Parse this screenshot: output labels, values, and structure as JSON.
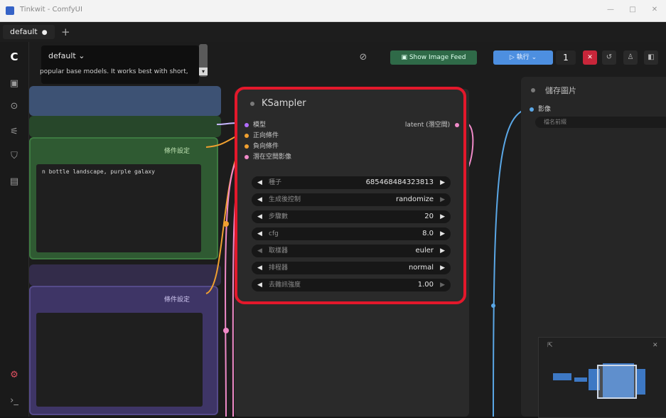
{
  "window": {
    "title": "Tinkwit - ComfyUI",
    "minimize": "—",
    "maximize": "□",
    "close": "✕"
  },
  "tabs": [
    {
      "label": "default",
      "modified_marker": "●"
    }
  ],
  "tab_add": "+",
  "sidebar": {
    "logo": "C",
    "icons": [
      "images-icon",
      "model-icon",
      "node-library-icon",
      "workflow-icon",
      "templates-icon",
      "settings-icon",
      "terminal-icon"
    ]
  },
  "workflow_panel": {
    "name": "default ⌄",
    "description": "popular base models. It works best with short,"
  },
  "toolbar": {
    "link_icon": "⊘",
    "image_feed": "Show Image Feed",
    "run": "▷ 執行",
    "run_dropdown": "⌄",
    "queue_count": "1",
    "stop": "✕"
  },
  "nodes": {
    "green_output_label": "條件設定",
    "green_prompt": "n bottle landscape, purple galaxy",
    "purple_output_label": "條件設定"
  },
  "ksampler": {
    "title": "KSampler",
    "inputs": [
      "模型",
      "正向條件",
      "負向條件",
      "潛在空間影像"
    ],
    "output": "latent (潛空間)",
    "widgets": [
      {
        "label": "種子",
        "value": "685468484323813",
        "disabled": false
      },
      {
        "label": "生成後控制",
        "value": "randomize",
        "disabled": true
      },
      {
        "label": "步驟數",
        "value": "20",
        "disabled": false
      },
      {
        "label": "cfg",
        "value": "8.0",
        "disabled": false
      },
      {
        "label": "取樣器",
        "value": "euler",
        "disabled": false
      },
      {
        "label": "排程器",
        "value": "normal",
        "disabled": false
      },
      {
        "label": "去雜訊強度",
        "value": "1.00",
        "disabled": true
      }
    ]
  },
  "save_node": {
    "title": "儲存圖片",
    "input": "影像",
    "field": "檔名前綴"
  },
  "colors": {
    "highlight": "#e3182b",
    "model_port": "#b26cff",
    "condition_port": "#f0a030",
    "latent_port": "#f08ac8",
    "image_wire": "#5aa7e6"
  }
}
